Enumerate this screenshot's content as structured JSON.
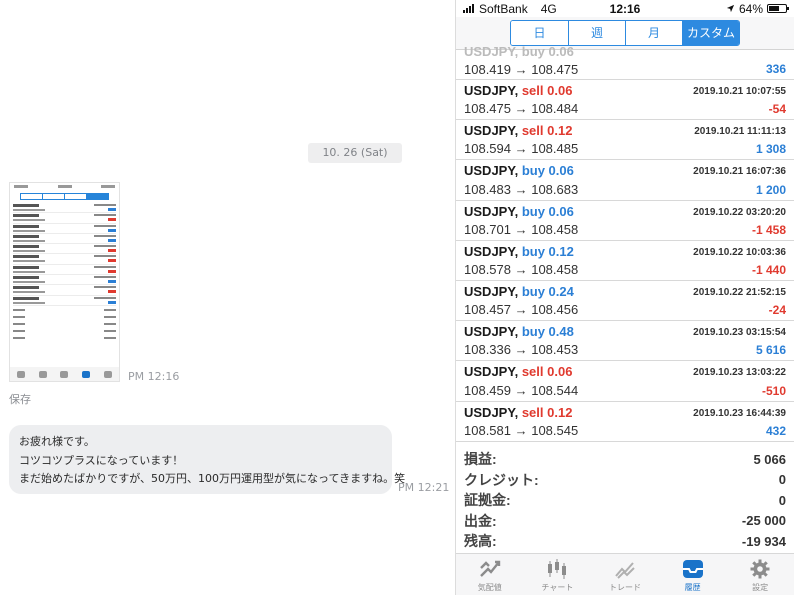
{
  "chat": {
    "date": "10. 26 (Sat)",
    "image_time": "PM 12:16",
    "save_label": "保存",
    "message_lines": [
      "お疲れ様です。",
      "コツコツプラスになっています！",
      "まだ始めたばかりですが、50万円、100万円運用型が気になってきますね。笑"
    ],
    "message_time": "PM 12:21"
  },
  "phone": {
    "status": {
      "carrier": "SoftBank",
      "network": "4G",
      "time": "12:16",
      "battery": "64%"
    },
    "segments": [
      {
        "label": "日",
        "active": false
      },
      {
        "label": "週",
        "active": false
      },
      {
        "label": "月",
        "active": false
      },
      {
        "label": "カスタム",
        "active": true
      }
    ],
    "partial_row": {
      "prices": "108.419 → 108.475",
      "pl": "336"
    },
    "trades": [
      {
        "symbol": "USDJPY,",
        "side": "sell 0.06",
        "kind": "sell",
        "prices": "108.475 → 108.484",
        "time": "2019.10.21 10:07:55",
        "pl": "-54"
      },
      {
        "symbol": "USDJPY,",
        "side": "sell 0.12",
        "kind": "sell",
        "prices": "108.594 → 108.485",
        "time": "2019.10.21 11:11:13",
        "pl": "1 308"
      },
      {
        "symbol": "USDJPY,",
        "side": "buy 0.06",
        "kind": "buy",
        "prices": "108.483 → 108.683",
        "time": "2019.10.21 16:07:36",
        "pl": "1 200"
      },
      {
        "symbol": "USDJPY,",
        "side": "buy 0.06",
        "kind": "buy",
        "prices": "108.701 → 108.458",
        "time": "2019.10.22 03:20:20",
        "pl": "-1 458"
      },
      {
        "symbol": "USDJPY,",
        "side": "buy 0.12",
        "kind": "buy",
        "prices": "108.578 → 108.458",
        "time": "2019.10.22 10:03:36",
        "pl": "-1 440"
      },
      {
        "symbol": "USDJPY,",
        "side": "buy 0.24",
        "kind": "buy",
        "prices": "108.457 → 108.456",
        "time": "2019.10.22 21:52:15",
        "pl": "-24"
      },
      {
        "symbol": "USDJPY,",
        "side": "buy 0.48",
        "kind": "buy",
        "prices": "108.336 → 108.453",
        "time": "2019.10.23 03:15:54",
        "pl": "5 616"
      },
      {
        "symbol": "USDJPY,",
        "side": "sell 0.06",
        "kind": "sell",
        "prices": "108.459 → 108.544",
        "time": "2019.10.23 13:03:22",
        "pl": "-510"
      },
      {
        "symbol": "USDJPY,",
        "side": "sell 0.12",
        "kind": "sell",
        "prices": "108.581 → 108.545",
        "time": "2019.10.23 16:44:39",
        "pl": "432"
      }
    ],
    "summary": [
      {
        "label": "損益:",
        "value": "5 066"
      },
      {
        "label": "クレジット:",
        "value": "0"
      },
      {
        "label": "証拠金:",
        "value": "0"
      },
      {
        "label": "出金:",
        "value": "-25 000"
      },
      {
        "label": "残高:",
        "value": "-19 934"
      }
    ],
    "tabs": [
      {
        "label": "気配値",
        "icon": "quotes-icon",
        "active": false
      },
      {
        "label": "チャート",
        "icon": "candlestick-icon",
        "active": false
      },
      {
        "label": "トレード",
        "icon": "trade-icon",
        "active": false
      },
      {
        "label": "履歴",
        "icon": "history-inbox-icon",
        "active": true
      },
      {
        "label": "設定",
        "icon": "gear-icon",
        "active": false
      }
    ],
    "colors": {
      "accent": "#2d8ae0",
      "buy": "#2b7fd5",
      "sell": "#e03a2f"
    }
  }
}
